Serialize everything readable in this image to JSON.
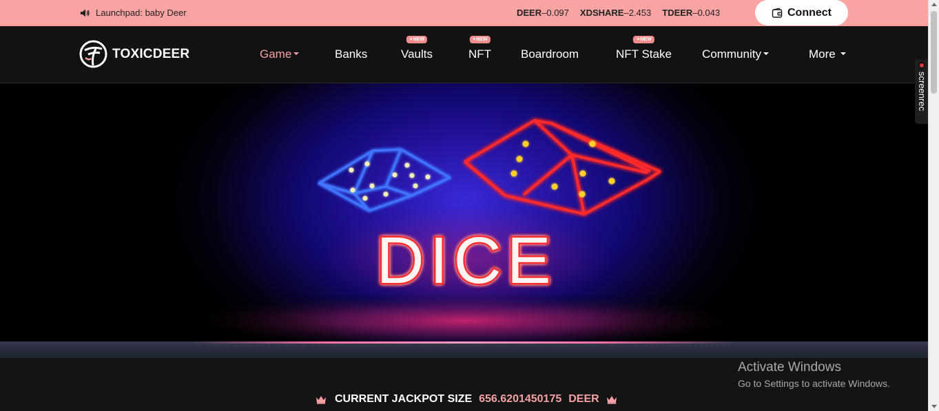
{
  "topbar": {
    "announcement": "Launchpad: baby Deer",
    "prices": [
      {
        "symbol": "DEER",
        "value": "0.097"
      },
      {
        "symbol": "XDSHARE",
        "value": "2.453"
      },
      {
        "symbol": "TDEER",
        "value": "0.043"
      }
    ],
    "connect_label": "Connect"
  },
  "nav": {
    "brand": "TOXICDEER",
    "items": [
      {
        "label": "Game",
        "dropdown": true,
        "active": true
      },
      {
        "label": "Banks"
      },
      {
        "label": "Vaults",
        "badge": "NEW"
      },
      {
        "label": "NFT",
        "badge": "NEW"
      },
      {
        "label": "Boardroom"
      },
      {
        "label": "NFT Stake",
        "badge": "NEW"
      },
      {
        "label": "Community",
        "dropdown": true
      },
      {
        "label": "More",
        "dropdown": true
      }
    ]
  },
  "hero": {
    "title": "DICE"
  },
  "jackpot": {
    "label": "CURRENT JACKPOT SIZE",
    "value": "656.6201450175",
    "unit": "DEER"
  },
  "watermark": {
    "title": "Activate Windows",
    "subtitle": "Go to Settings to activate Windows."
  },
  "screenrec": {
    "label": "screenrec"
  },
  "colors": {
    "topbar_bg": "#f9a3a3",
    "accent": "#f6a1a1",
    "nav_bg": "#121212",
    "neon_red": "#ff2a2a",
    "neon_blue": "#3a6bff"
  },
  "icons": [
    "speaker-icon",
    "wallet-icon",
    "logo-mark-icon",
    "crown-icon"
  ]
}
